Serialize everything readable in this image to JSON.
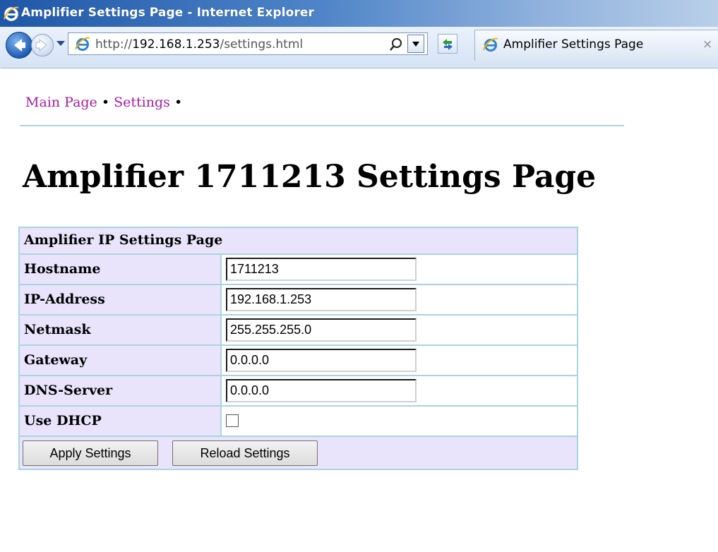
{
  "window": {
    "title": "Amplifier Settings Page - Internet Explorer"
  },
  "browser": {
    "url_prefix": "http://",
    "url_host": "192.168.1.253",
    "url_path": "/settings.html",
    "tab_label": "Amplifier Settings Page",
    "tab_close": "×",
    "icons": [
      "ie-logo-icon",
      "back-arrow-icon",
      "forward-arrow-icon",
      "dropdown-arrow-icon",
      "page-icon",
      "search-icon",
      "refresh-icon",
      "close-icon"
    ]
  },
  "breadcrumb": {
    "main": "Main Page",
    "settings": "Settings",
    "separator": "•"
  },
  "page": {
    "title": "Amplifier 1711213 Settings Page"
  },
  "settings": {
    "header": "Amplifier IP Settings Page",
    "rows": [
      {
        "label": "Hostname",
        "value": "1711213"
      },
      {
        "label": "IP-Address",
        "value": "192.168.1.253"
      },
      {
        "label": "Netmask",
        "value": "255.255.255.0"
      },
      {
        "label": "Gateway",
        "value": "0.0.0.0"
      },
      {
        "label": "DNS-Server",
        "value": "0.0.0.0"
      }
    ],
    "dhcp_label": "Use DHCP",
    "dhcp_checked": false,
    "apply_label": "Apply Settings",
    "reload_label": "Reload Settings"
  },
  "colors": {
    "link": "#a41ca4",
    "table_border": "#a8d4e0",
    "label_bg": "#e9e4fc",
    "titlebar": "#1f57a8"
  }
}
